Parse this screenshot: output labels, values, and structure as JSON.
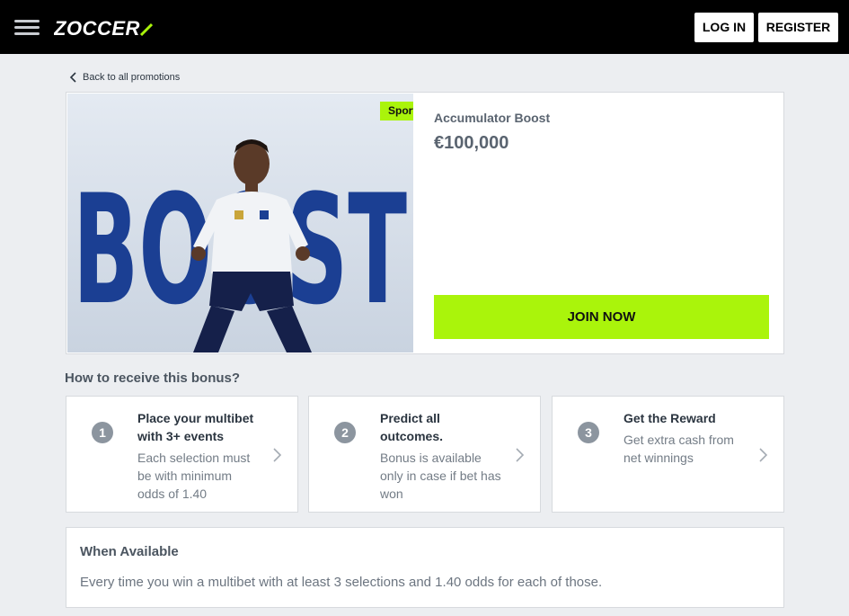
{
  "header": {
    "logo_text": "ZOCCER",
    "login_label": "LOG IN",
    "register_label": "REGISTER"
  },
  "nav": {
    "back_label": "Back to all promotions"
  },
  "promo": {
    "badge": "Sport",
    "name": "Accumulator Boost",
    "amount": "€100,000",
    "join_label": "JOIN NOW",
    "image_text": "BOOST"
  },
  "how": {
    "title": "How to receive this bonus?",
    "steps": [
      {
        "number": "1",
        "title": "Place your multibet with 3+ events",
        "desc": "Each selection must be with minimum odds of 1.40"
      },
      {
        "number": "2",
        "title": "Predict all outcomes.",
        "desc": "Bonus is available only in case if bet has won"
      },
      {
        "number": "3",
        "title": "Get the Reward",
        "desc": "Get extra cash from net winnings"
      }
    ]
  },
  "when": {
    "title": "When Available",
    "text": "Every time you win a multibet with at least 3 selections and 1.40 odds for each of those."
  },
  "colors": {
    "accent": "#aaf40b",
    "topbar": "#000000",
    "background": "#eceef1",
    "step_badge": "#8c959f"
  }
}
